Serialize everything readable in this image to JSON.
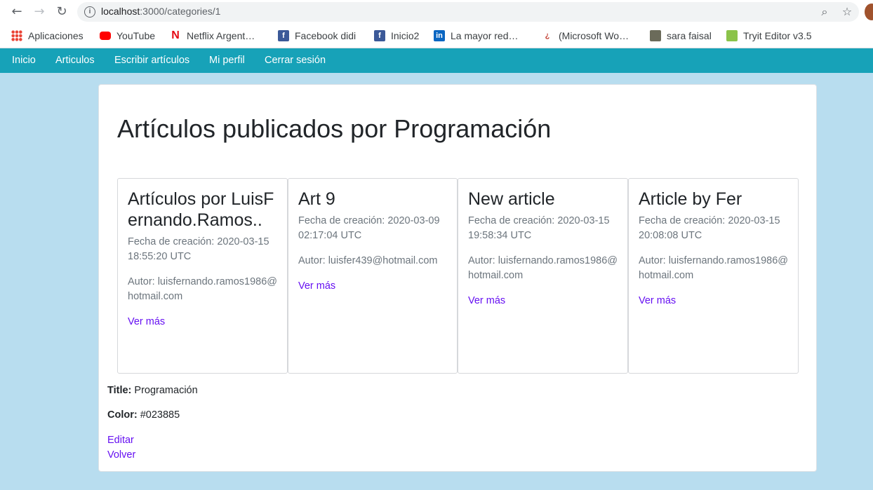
{
  "browser": {
    "url_host": "localhost",
    "url_path": ":3000/categories/1",
    "bookmarks": [
      {
        "label": "Aplicaciones",
        "icon": "apps-grid-icon"
      },
      {
        "label": "YouTube",
        "icon": "youtube-icon"
      },
      {
        "label": "Netflix Argent…",
        "icon": "netflix-icon"
      },
      {
        "label": "Facebook didi",
        "icon": "facebook-icon"
      },
      {
        "label": "Inicio2",
        "icon": "facebook-icon"
      },
      {
        "label": "La mayor red…",
        "icon": "linkedin-icon"
      },
      {
        "label": "(Microsoft Wo…",
        "icon": "microsoft-icon"
      },
      {
        "label": "sara faisal",
        "icon": "image-icon"
      },
      {
        "label": "Tryit Editor v3.5",
        "icon": "tryit-icon"
      }
    ]
  },
  "navbar": {
    "items": [
      "Inicio",
      "Articulos",
      "Escribir artículos",
      "Mi perfil",
      "Cerrar sesión"
    ]
  },
  "page": {
    "title": "Artículos publicados por Programación"
  },
  "articles": [
    {
      "title": "Artículos por LuisFernando.Ramos..",
      "date": "Fecha de creación: 2020-03-15 18:55:20 UTC",
      "author": "Autor: luisfernando.ramos1986@hotmail.com",
      "link": "Ver más"
    },
    {
      "title": "Art 9",
      "date": "Fecha de creación: 2020-03-09 02:17:04 UTC",
      "author": "Autor: luisfer439@hotmail.com",
      "link": "Ver más"
    },
    {
      "title": "New article",
      "date": "Fecha de creación: 2020-03-15 19:58:34 UTC",
      "author": "Autor: luisfernando.ramos1986@hotmail.com",
      "link": "Ver más"
    },
    {
      "title": "Article by Fer",
      "date": "Fecha de creación: 2020-03-15 20:08:08 UTC",
      "author": "Autor: luisfernando.ramos1986@hotmail.com",
      "link": "Ver más"
    }
  ],
  "category": {
    "title_label": "Title:",
    "title_value": "Programación",
    "color_label": "Color:",
    "color_value": "#023885"
  },
  "actions": {
    "edit": "Editar",
    "back": "Volver"
  },
  "colors": {
    "navbar": "#17a2b8",
    "background": "#b8ddef",
    "link": "#6610f2"
  }
}
